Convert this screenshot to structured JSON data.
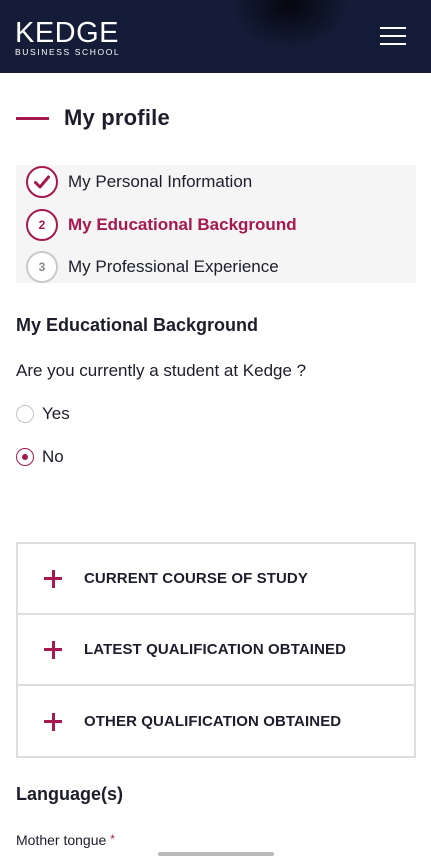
{
  "header": {
    "logo_main": "KEDGE",
    "logo_sub": "BUSINESS SCHOOL",
    "menu_icon": "hamburger-menu-icon"
  },
  "page": {
    "title": "My profile"
  },
  "steps": [
    {
      "number": "1",
      "label": "My Personal Information",
      "state": "completed"
    },
    {
      "number": "2",
      "label": "My Educational Background",
      "state": "active"
    },
    {
      "number": "3",
      "label": "My Professional Experience",
      "state": "upcoming"
    }
  ],
  "education": {
    "section_title": "My Educational Background",
    "question": "Are you currently a student at Kedge ?",
    "options": [
      {
        "label": "Yes",
        "selected": false
      },
      {
        "label": "No",
        "selected": true
      }
    ]
  },
  "accordion": [
    {
      "label": "CURRENT COURSE OF STUDY"
    },
    {
      "label": "LATEST QUALIFICATION OBTAINED"
    },
    {
      "label": "OTHER QUALIFICATION OBTAINED"
    }
  ],
  "languages": {
    "section_title": "Language(s)",
    "mother_tongue_label": "Mother tongue",
    "required_mark": "*"
  },
  "colors": {
    "brand_navy": "#141c38",
    "accent": "#a6184f"
  }
}
